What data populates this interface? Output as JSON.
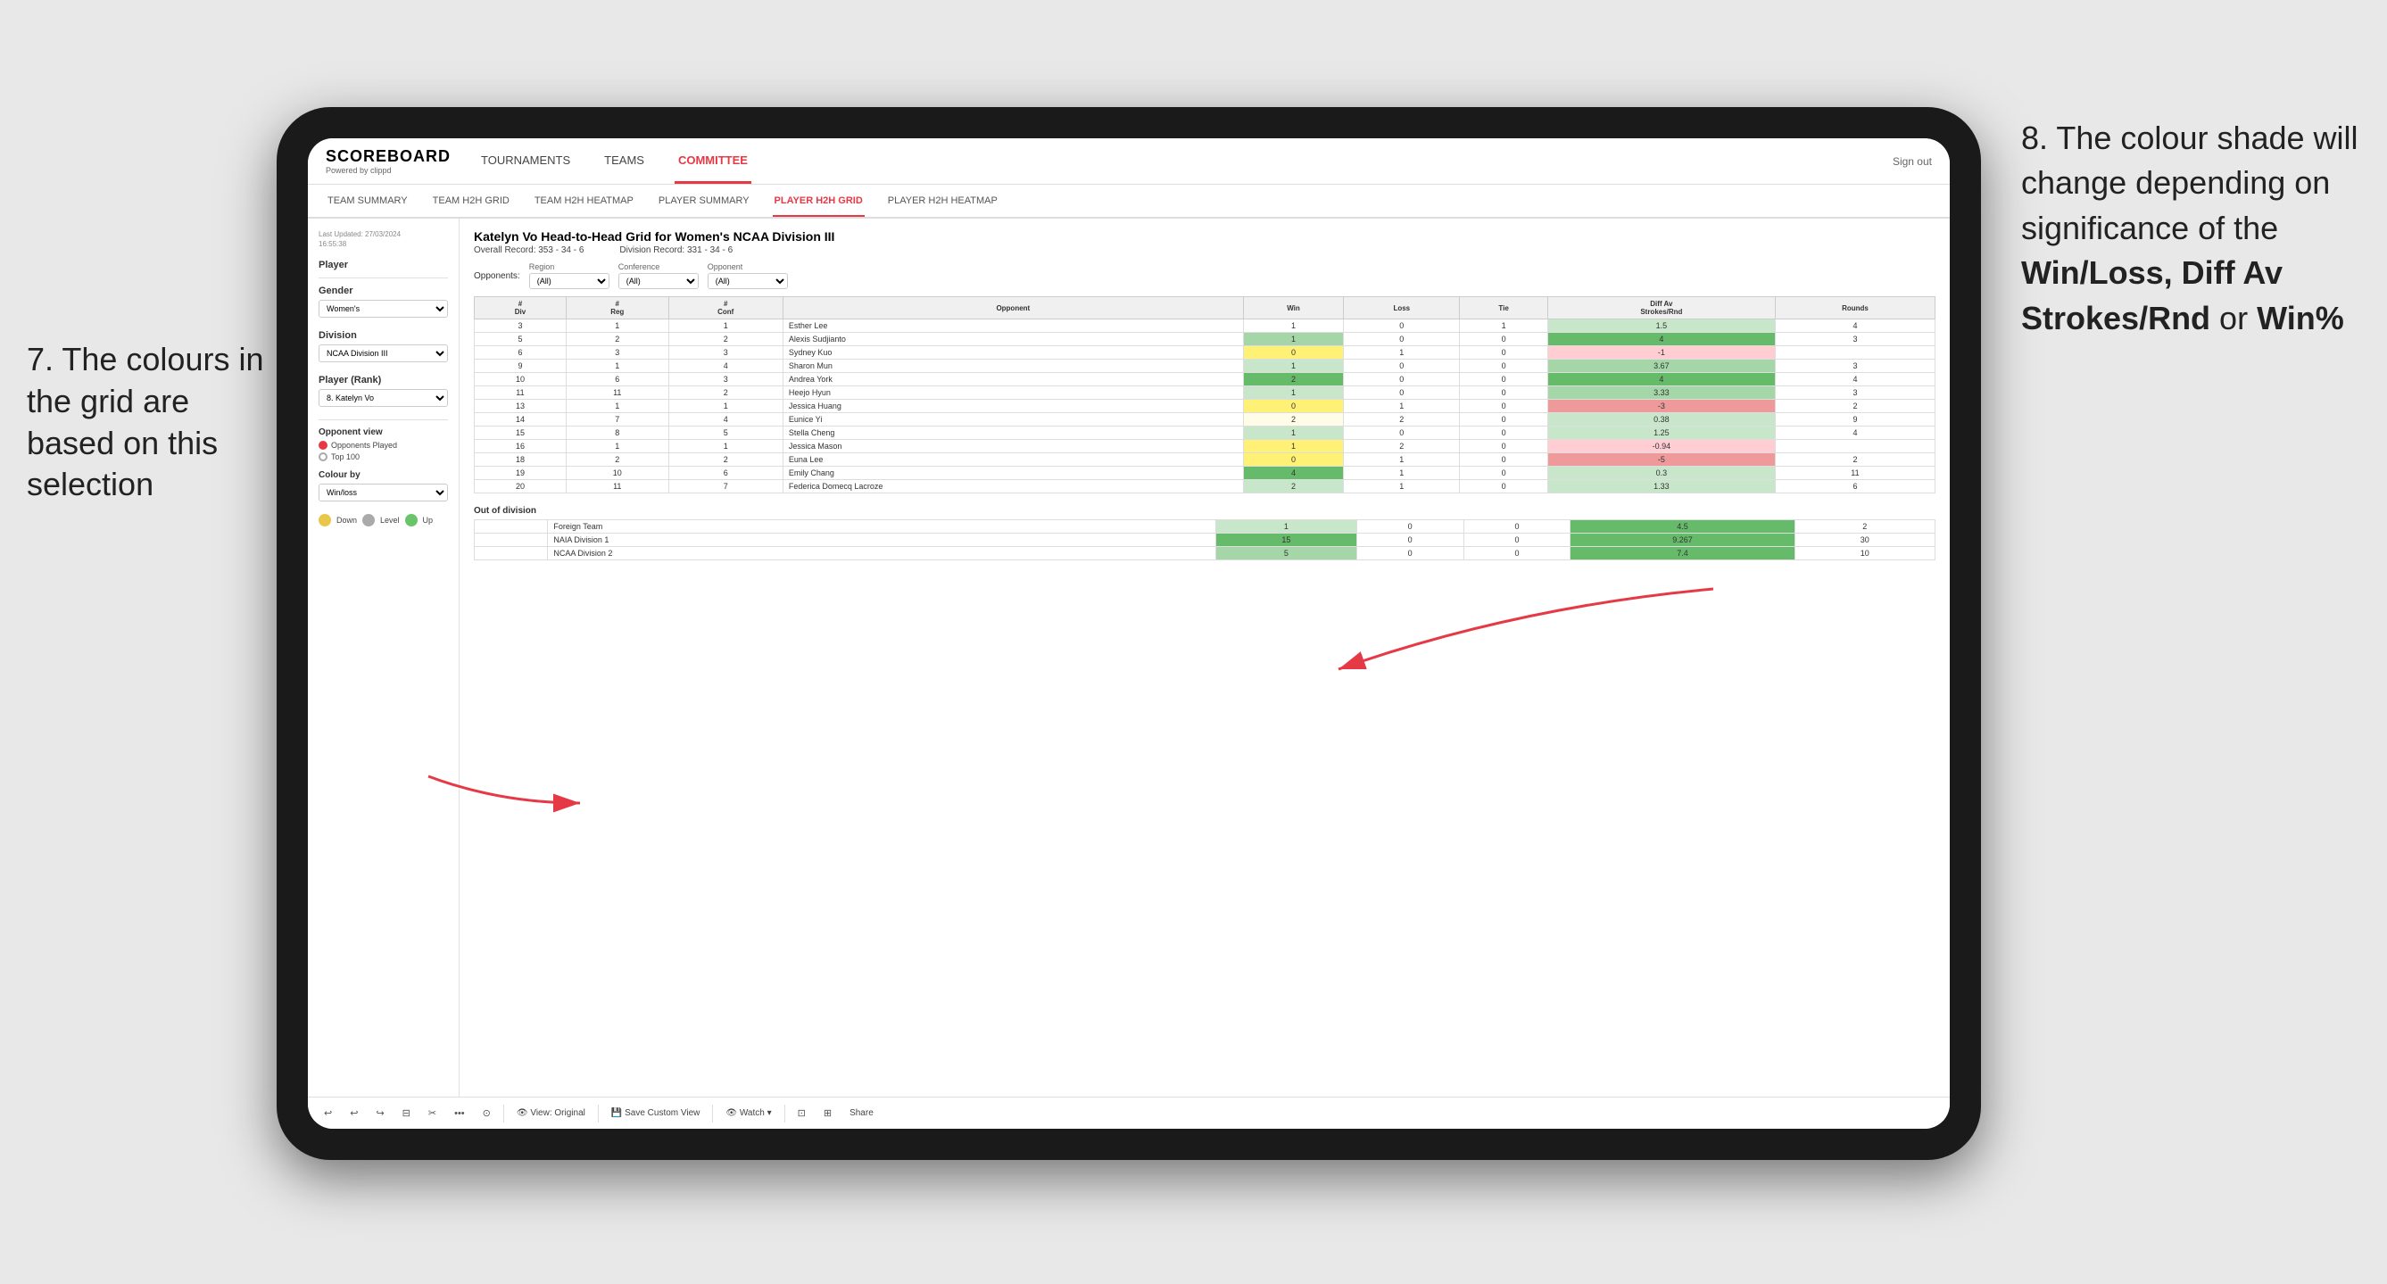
{
  "annotations": {
    "left_title": "7. The colours in the grid are based on this selection",
    "right_title": "8. The colour shade will change depending on significance of the ",
    "right_bold": "Win/Loss, Diff Av Strokes/Rnd",
    "right_or": " or ",
    "right_bold2": "Win%"
  },
  "nav": {
    "logo": "SCOREBOARD",
    "logo_sub": "Powered by clippd",
    "items": [
      "TOURNAMENTS",
      "TEAMS",
      "COMMITTEE"
    ],
    "active_item": "COMMITTEE",
    "sign_in": "Sign out"
  },
  "second_nav": {
    "items": [
      "TEAM SUMMARY",
      "TEAM H2H GRID",
      "TEAM H2H HEATMAP",
      "PLAYER SUMMARY",
      "PLAYER H2H GRID",
      "PLAYER H2H HEATMAP"
    ],
    "active_item": "PLAYER H2H GRID"
  },
  "sidebar": {
    "last_updated_label": "Last Updated: 27/03/2024",
    "last_updated_time": "16:55:38",
    "player_section": "Player",
    "gender_label": "Gender",
    "gender_value": "Women's",
    "division_label": "Division",
    "division_value": "NCAA Division III",
    "player_rank_label": "Player (Rank)",
    "player_rank_value": "8. Katelyn Vo",
    "opponent_view_label": "Opponent view",
    "radio_options": [
      "Opponents Played",
      "Top 100"
    ],
    "selected_radio": "Opponents Played",
    "colour_by_label": "Colour by",
    "colour_by_value": "Win/loss",
    "legend_items": [
      {
        "color": "#e8c84a",
        "label": "Down"
      },
      {
        "color": "#aaaaaa",
        "label": "Level"
      },
      {
        "color": "#6ac46a",
        "label": "Up"
      }
    ]
  },
  "grid": {
    "title": "Katelyn Vo Head-to-Head Grid for Women's NCAA Division III",
    "overall_record_label": "Overall Record:",
    "overall_record": "353 - 34 - 6",
    "division_record_label": "Division Record:",
    "division_record": "331 - 34 - 6",
    "filter_opponents_label": "Opponents:",
    "filter_region_label": "Region",
    "filter_conference_label": "Conference",
    "filter_opponent_label": "Opponent",
    "filter_opponents_value": "(All)",
    "filter_region_value": "(All)",
    "filter_conference_value": "(All)",
    "filter_opponent_value": "(All)",
    "table_headers": [
      "#\nDiv",
      "#\nReg",
      "#\nConf",
      "Opponent",
      "Win",
      "Loss",
      "Tie",
      "Diff Av\nStrokes/Rnd",
      "Rounds"
    ],
    "rows": [
      {
        "div": 3,
        "reg": 1,
        "conf": 1,
        "opponent": "Esther Lee",
        "win": 1,
        "loss": 0,
        "tie": 1,
        "diff": 1.5,
        "rounds": 4,
        "win_color": "white",
        "diff_color": "green_light"
      },
      {
        "div": 5,
        "reg": 2,
        "conf": 2,
        "opponent": "Alexis Sudjianto",
        "win": 1,
        "loss": 0,
        "tie": 0,
        "diff": 4.0,
        "rounds": 3,
        "win_color": "green_mid",
        "diff_color": "green_dark"
      },
      {
        "div": 6,
        "reg": 3,
        "conf": 3,
        "opponent": "Sydney Kuo",
        "win": 0,
        "loss": 1,
        "tie": 0,
        "diff": -1.0,
        "rounds": "",
        "win_color": "yellow",
        "diff_color": "red_light"
      },
      {
        "div": 9,
        "reg": 1,
        "conf": 4,
        "opponent": "Sharon Mun",
        "win": 1,
        "loss": 0,
        "tie": 0,
        "diff": 3.67,
        "rounds": 3,
        "win_color": "green_light",
        "diff_color": "green_mid"
      },
      {
        "div": 10,
        "reg": 6,
        "conf": 3,
        "opponent": "Andrea York",
        "win": 2,
        "loss": 0,
        "tie": 0,
        "diff": 4.0,
        "rounds": 4,
        "win_color": "green_dark",
        "diff_color": "green_dark"
      },
      {
        "div": 11,
        "reg": 11,
        "conf": 2,
        "opponent": "Heejo Hyun",
        "win": 1,
        "loss": 0,
        "tie": 0,
        "diff": 3.33,
        "rounds": 3,
        "win_color": "green_light",
        "diff_color": "green_mid"
      },
      {
        "div": 13,
        "reg": 1,
        "conf": 1,
        "opponent": "Jessica Huang",
        "win": 0,
        "loss": 1,
        "tie": 0,
        "diff": -3.0,
        "rounds": 2,
        "win_color": "yellow",
        "diff_color": "red_dark"
      },
      {
        "div": 14,
        "reg": 7,
        "conf": 4,
        "opponent": "Eunice Yi",
        "win": 2,
        "loss": 2,
        "tie": 0,
        "diff": 0.38,
        "rounds": 9,
        "win_color": "yellow_light",
        "diff_color": "green_light"
      },
      {
        "div": 15,
        "reg": 8,
        "conf": 5,
        "opponent": "Stella Cheng",
        "win": 1,
        "loss": 0,
        "tie": 0,
        "diff": 1.25,
        "rounds": 4,
        "win_color": "green_light",
        "diff_color": "green_light"
      },
      {
        "div": 16,
        "reg": 1,
        "conf": 1,
        "opponent": "Jessica Mason",
        "win": 1,
        "loss": 2,
        "tie": 0,
        "diff": -0.94,
        "rounds": "",
        "win_color": "yellow",
        "diff_color": "red_light"
      },
      {
        "div": 18,
        "reg": 2,
        "conf": 2,
        "opponent": "Euna Lee",
        "win": 0,
        "loss": 1,
        "tie": 0,
        "diff": -5.0,
        "rounds": 2,
        "win_color": "yellow",
        "diff_color": "red_dark"
      },
      {
        "div": 19,
        "reg": 10,
        "conf": 6,
        "opponent": "Emily Chang",
        "win": 4,
        "loss": 1,
        "tie": 0,
        "diff": 0.3,
        "rounds": 11,
        "win_color": "green_dark",
        "diff_color": "green_light"
      },
      {
        "div": 20,
        "reg": 11,
        "conf": 7,
        "opponent": "Federica Domecq Lacroze",
        "win": 2,
        "loss": 1,
        "tie": 0,
        "diff": 1.33,
        "rounds": 6,
        "win_color": "green_light",
        "diff_color": "green_light"
      }
    ],
    "out_of_division_label": "Out of division",
    "out_of_division_rows": [
      {
        "opponent": "Foreign Team",
        "win": 1,
        "loss": 0,
        "tie": 0,
        "diff": 4.5,
        "rounds": 2,
        "win_color": "green_light",
        "diff_color": "green_dark"
      },
      {
        "opponent": "NAIA Division 1",
        "win": 15,
        "loss": 0,
        "tie": 0,
        "diff": 9.267,
        "rounds": 30,
        "win_color": "green_dark",
        "diff_color": "green_dark"
      },
      {
        "opponent": "NCAA Division 2",
        "win": 5,
        "loss": 0,
        "tie": 0,
        "diff": 7.4,
        "rounds": 10,
        "win_color": "green_mid",
        "diff_color": "green_dark"
      }
    ]
  },
  "toolbar": {
    "buttons": [
      "↩",
      "↩",
      "↪",
      "⊟",
      "✂",
      "·",
      "⊙",
      "|",
      "👁 View: Original",
      "|",
      "💾 Save Custom View",
      "|",
      "👁 Watch ▾",
      "|",
      "⊡",
      "⊞",
      "Share"
    ]
  }
}
